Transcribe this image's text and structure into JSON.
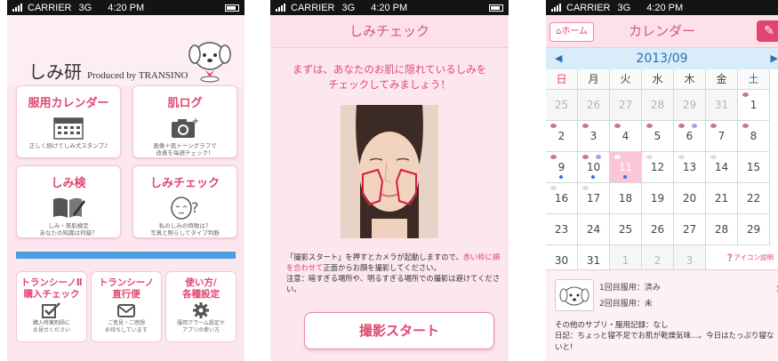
{
  "status": {
    "carrier": "CARRIER",
    "network": "3G",
    "time": "4:20 PM"
  },
  "home": {
    "logo": "しみ研",
    "produced_by": "Produced by TRANSINO",
    "tiles": [
      {
        "title": "服用カレンダー",
        "icon": "calendar-icon",
        "desc": "正しく続けてしみ犬スタンプ♪"
      },
      {
        "title": "肌ログ",
        "icon": "camera-icon",
        "desc": "画像＋肌トーングラフで\n改善を毎週チェック！"
      },
      {
        "title": "しみ検",
        "icon": "book-pen-icon",
        "desc": "しみ・美肌検定\nあなたの知識は何級？"
      },
      {
        "title": "しみチェック",
        "icon": "face-question-icon",
        "desc": "私のしみの特徴は？\n写真と照らしてタイプ判断"
      }
    ],
    "bottom_tiles": [
      {
        "title": "トランシーノⅡ\n購入チェック",
        "icon": "checkbox-icon",
        "desc": "購入時薬剤師に\nお見せください"
      },
      {
        "title": "トランシーノ\n直行便",
        "icon": "mail-icon",
        "desc": "ご意見・ご感想\nお待ちしています"
      },
      {
        "title": "使い方/\n各種設定",
        "icon": "gear-icon",
        "desc": "服用アラーム設定や\nアプリの使い方"
      }
    ]
  },
  "check": {
    "title": "しみチェック",
    "lead": "まずは、あなたのお肌に隠れているしみを\nチェックしてみましょう！",
    "text_before_red": "「撮影スタート」を押すとカメラが起動しますので、",
    "text_red": "赤い枠に頬を合わせて",
    "text_after_red": "正面からお顔を撮影してください。",
    "note": "注意：暗すぎる場所や、明るすぎる場所での撮影は避けてください。",
    "button": "撮影スタート"
  },
  "calendar": {
    "home_button": "ホーム",
    "title": "カレンダー",
    "month": "2013/09",
    "weekdays": [
      "日",
      "月",
      "火",
      "水",
      "木",
      "金",
      "土"
    ],
    "weeks": [
      [
        "25",
        "26",
        "27",
        "28",
        "29",
        "31",
        "1"
      ],
      [
        "2",
        "3",
        "4",
        "5",
        "6",
        "7",
        "8"
      ],
      [
        "9",
        "10",
        "11",
        "12",
        "13",
        "14",
        "15"
      ],
      [
        "16",
        "17",
        "18",
        "19",
        "20",
        "21",
        "22"
      ],
      [
        "23",
        "24",
        "25",
        "26",
        "27",
        "28",
        "29"
      ],
      [
        "30",
        "31",
        "1",
        "2",
        "3",
        "",
        ""
      ]
    ],
    "icon_help": "アイコン説明",
    "dose1": "1回目服用：済み",
    "dose2": "2回目服用：未",
    "supplement": "その他のサプリ・服用記録：なし",
    "diary": "日記：ちょっと寝不足でお肌が乾燥気味…。今日はたっぷり寝ないと!",
    "colors": {
      "accent": "#e2466f",
      "header_bg": "#fde0ea",
      "month_bar": "#d9ecfa",
      "today": "#fbc6d6"
    }
  }
}
